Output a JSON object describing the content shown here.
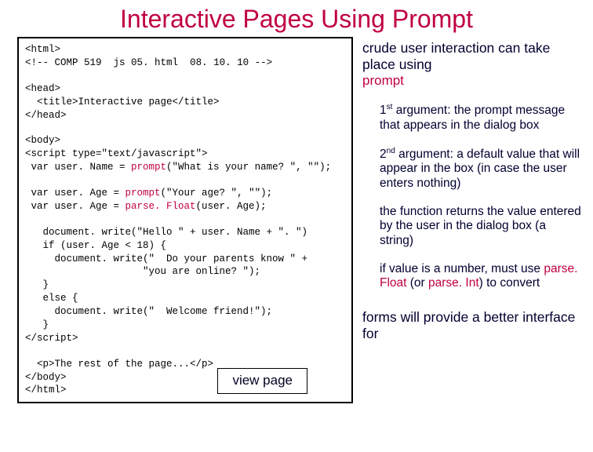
{
  "title": "Interactive Pages Using Prompt",
  "code": {
    "l1": "<html>",
    "l2a": "<!-- COMP 519",
    "l2b": "js 05. html",
    "l2c": "08. 10. 10 -->",
    "l3": "<head>",
    "l4": "  <title>Interactive page</title>",
    "l5": "</head>",
    "l6": "<body>",
    "l7": "<script type=\"text/javascript\">",
    "l8a": " var user. Name = ",
    "l8b": "prompt",
    "l8c": "(\"What is your name? \", \"\");",
    "l9a": " var user. Age = ",
    "l9b": "prompt",
    "l9c": "(\"Your age? \", \"\");",
    "l10a": " var user. Age = ",
    "l10b": "parse. Float",
    "l10c": "(user. Age);",
    "l11": "   document. write(\"Hello \" + user. Name + \". \")",
    "l12": "   if (user. Age < 18) {",
    "l13": "     document. write(\"  Do your parents know \" +",
    "l14": "                    \"you are online? \");",
    "l15": "   }",
    "l16": "   else {",
    "l17": "     document. write(\"  Welcome friend!\");",
    "l18": "   }",
    "l19": "</script>",
    "l20": "  <p>The rest of the page...</p>",
    "l21": "</body>",
    "l22": "</html>"
  },
  "viewpage_label": "view page",
  "right": {
    "lead": "crude user interaction can take place using",
    "prompt_word": "prompt",
    "p1a": "1",
    "p1b": "st",
    "p1c": " argument: the prompt message that appears in the dialog box",
    "p2a": "2",
    "p2b": "nd",
    "p2c": " argument: a default value that will appear in the box (in case the user enters nothing)",
    "p3": "the function returns the value entered by the user in the dialog box (a string)",
    "p4a": "if value is a number, must use ",
    "p4b": "parse. Float",
    "p4c": " (or ",
    "p4d": "parse. Int",
    "p4e": ") to convert",
    "footer": "forms will provide a better interface for"
  }
}
